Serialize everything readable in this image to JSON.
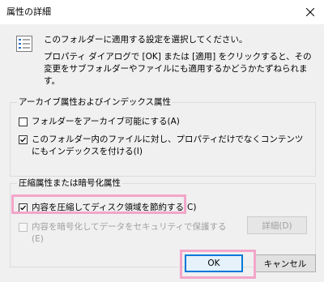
{
  "window": {
    "title": "属性の詳細"
  },
  "intro": {
    "line1": "このフォルダーに適用する設定を選択してください。",
    "line2": "プロパティ ダイアログで [OK] または [適用] をクリックすると、その変更をサブフォルダーやファイルにも適用するかどうかたずねられます。"
  },
  "archive_group": {
    "title": "アーカイブ属性およびインデックス属性",
    "items": [
      {
        "label": "フォルダーをアーカイブ可能にする(A)",
        "checked": false
      },
      {
        "label": "このフォルダー内のファイルに対し、プロパティだけでなくコンテンツにもインデックスを付ける(I)",
        "checked": true
      }
    ]
  },
  "compress_group": {
    "title": "圧縮属性または暗号化属性",
    "items": [
      {
        "label": "内容を圧縮してディスク領域を節約する(C)",
        "checked": true,
        "enabled": true
      },
      {
        "label": "内容を暗号化してデータをセキュリティで保護する(E)",
        "checked": false,
        "enabled": false
      }
    ],
    "details_label": "詳細(D)"
  },
  "buttons": {
    "ok": "OK",
    "cancel": "キャンセル"
  },
  "icons": {
    "close": "close-icon",
    "info": "settings-list-icon"
  },
  "colors": {
    "highlight": "#f3a6c9",
    "default_button_border": "#0078d7"
  }
}
